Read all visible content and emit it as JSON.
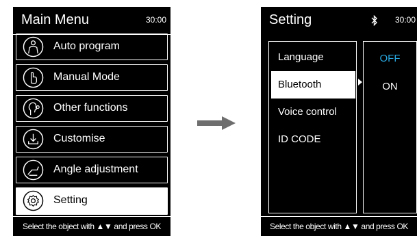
{
  "main_menu": {
    "title": "Main Menu",
    "time": "30:00",
    "items": [
      {
        "label": "Auto program",
        "icon": "person-icon"
      },
      {
        "label": "Manual Mode",
        "icon": "hand-pointer-icon"
      },
      {
        "label": "Other functions",
        "icon": "head-profile-icon"
      },
      {
        "label": "Customise",
        "icon": "download-icon"
      },
      {
        "label": "Angle adjustment",
        "icon": "chair-angle-icon"
      },
      {
        "label": "Setting",
        "icon": "gear-icon"
      }
    ],
    "selected_index": 5,
    "footer": "Select the object with ▲▼ and press OK"
  },
  "arrow": {
    "icon": "right-arrow-icon"
  },
  "setting": {
    "title": "Setting",
    "time": "30:00",
    "bluetooth_icon": "bluetooth-icon",
    "items": [
      {
        "label": "Language"
      },
      {
        "label": "Bluetooth"
      },
      {
        "label": "Voice control"
      },
      {
        "label": "ID CODE"
      }
    ],
    "selected_index": 1,
    "options": [
      {
        "label": "OFF",
        "color": "#29a8e0"
      },
      {
        "label": "ON",
        "color": "#ffffff"
      }
    ],
    "footer": "Select the object with ▲▼ and press OK"
  }
}
